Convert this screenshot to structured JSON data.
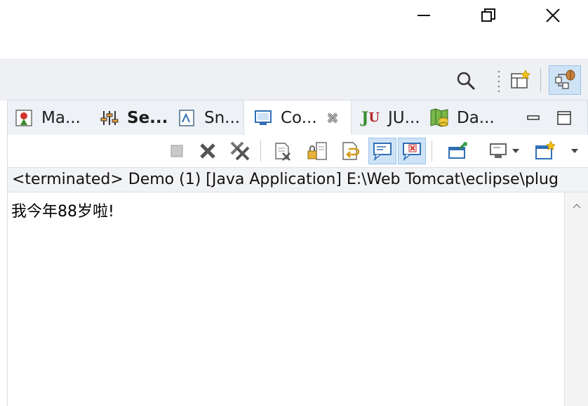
{
  "window": {
    "minimize_icon": "minimize-icon",
    "restore_icon": "restore-icon",
    "close_icon": "close-icon"
  },
  "toolbar": {
    "items": [
      "search-icon",
      "open-perspective-icon",
      "debug-perspective-icon"
    ]
  },
  "tabs": [
    {
      "label": "Ma...",
      "icon": "markers-icon"
    },
    {
      "label": "Se...",
      "icon": "servers-icon",
      "bold": true
    },
    {
      "label": "Sn...",
      "icon": "snippets-icon"
    },
    {
      "label": "Co...",
      "icon": "console-icon",
      "active": true,
      "close_icon": "tab-close-icon"
    },
    {
      "label": "JU...",
      "icon_text": "Ju",
      "icon": "junit-icon"
    },
    {
      "label": "Da...",
      "icon": "data-source-explorer-icon"
    }
  ],
  "console_toolbar": {
    "items": [
      "terminate-icon",
      "remove-launch-icon",
      "remove-all-terminated-icon",
      "clear-console-icon",
      "scroll-lock-icon",
      "word-wrap-icon",
      "show-on-stdout-icon",
      "show-on-stderr-icon",
      "pin-console-icon",
      "display-console-icon",
      "open-console-icon"
    ]
  },
  "status": {
    "text": "<terminated> Demo (1) [Java Application] E:\\Web Tomcat\\eclipse\\plug"
  },
  "console": {
    "output": "我今年88岁啦!"
  },
  "colors": {
    "accent_blue": "#2f6fb5",
    "pressed_bg": "#cfe3f6",
    "toolbar_bg": "#eef0f3"
  }
}
